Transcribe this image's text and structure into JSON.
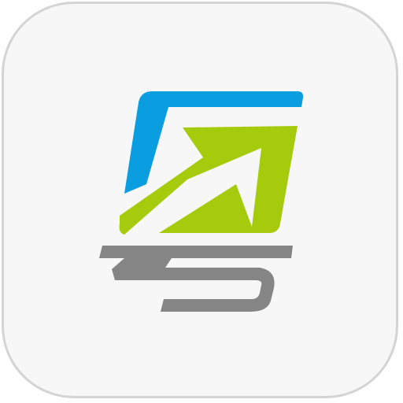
{
  "app_icon": {
    "icon_name": "app-logo-icon",
    "colors": {
      "tile_background": "#f7f7f7",
      "tile_border": "#d4d4d4",
      "blue_panel": "#0a9ee0",
      "green_panel": "#a6cb0c",
      "gray_glyph": "#858585"
    }
  }
}
